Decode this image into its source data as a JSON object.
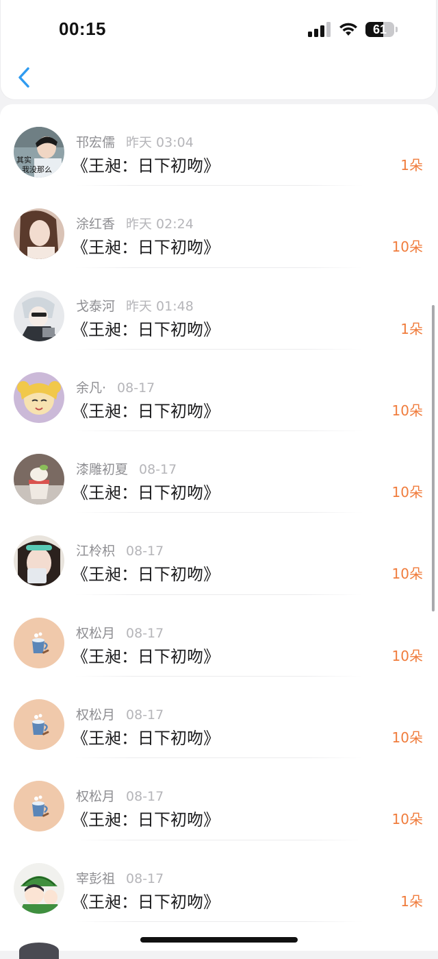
{
  "status_bar": {
    "time": "00:15",
    "battery": "61",
    "battery_level": 0.61
  },
  "nav": {
    "back_icon": "chevron-left-icon",
    "accent_color": "#2f9bf0"
  },
  "colors": {
    "count": "#f07c3c",
    "title": "#1b1b1d",
    "meta": "#9b9b9f"
  },
  "rows": [
    {
      "name": "邗宏儒",
      "time": "昨天 03:04",
      "title": "《王昶：日下初吻》",
      "count": "1朵",
      "avatar": "photo-boy-avatar"
    },
    {
      "name": "涂红香",
      "time": "昨天 02:24",
      "title": "《王昶：日下初吻》",
      "count": "10朵",
      "avatar": "photo-girl-avatar"
    },
    {
      "name": "戈泰河",
      "time": "昨天 01:48",
      "title": "《王昶：日下初吻》",
      "count": "1朵",
      "avatar": "anime-avatar"
    },
    {
      "name": "余凡·",
      "time": "08-17",
      "title": "《王昶：日下初吻》",
      "count": "10朵",
      "avatar": "sailor-moon-avatar"
    },
    {
      "name": "漆雕初夏",
      "time": "08-17",
      "title": "《王昶：日下初吻》",
      "count": "10朵",
      "avatar": "dessert-avatar"
    },
    {
      "name": "江柃枳",
      "time": "08-17",
      "title": "《王昶：日下初吻》",
      "count": "10朵",
      "avatar": "selfie-avatar"
    },
    {
      "name": "权松月",
      "time": "08-17",
      "title": "《王昶：日下初吻》",
      "count": "10朵",
      "avatar": "default-cup-avatar"
    },
    {
      "name": "权松月",
      "time": "08-17",
      "title": "《王昶：日下初吻》",
      "count": "10朵",
      "avatar": "default-cup-avatar"
    },
    {
      "name": "权松月",
      "time": "08-17",
      "title": "《王昶：日下初吻》",
      "count": "10朵",
      "avatar": "default-cup-avatar"
    },
    {
      "name": "宰彭祖",
      "time": "08-17",
      "title": "《王昶：日下初吻》",
      "count": "1朵",
      "avatar": "cartoon-boy-avatar"
    }
  ],
  "avatar_caption": "其实\n我没那么"
}
